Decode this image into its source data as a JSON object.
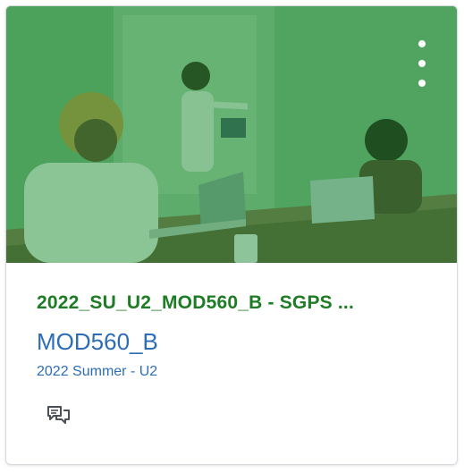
{
  "card": {
    "title": "2022_SU_U2_MOD560_B - SGPS ...",
    "code": "MOD560_B",
    "term": "2022 Summer - U2",
    "overlay_color": "#1b8c2d",
    "title_color": "#1e7c24",
    "link_color": "#2d6db5",
    "icons": {
      "menu": "kebab-menu-icon",
      "discussions": "discussions-icon"
    }
  }
}
